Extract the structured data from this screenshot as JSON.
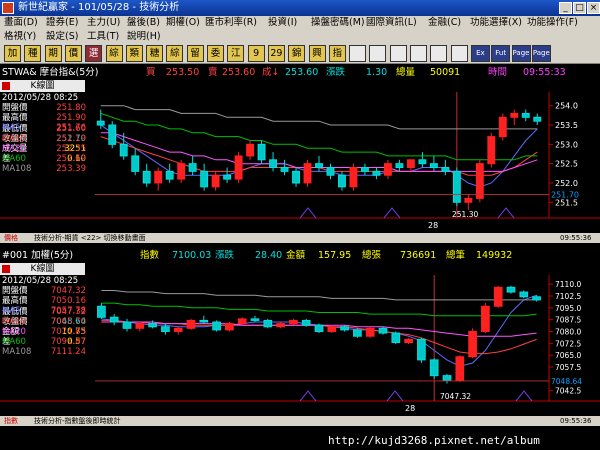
{
  "window": {
    "title": "新世紀贏家 - 101/05/28 - 技術分析"
  },
  "menu_row1": [
    "畫面(D)",
    "證券(E)",
    "主力(U)",
    "盤後(B)",
    "期權(O)",
    "匯市利率(R)",
    "投資(I)",
    "操盤密碼(M)",
    "國際資訊(L)",
    "金融(C)",
    "功能選擇(X)",
    "功能操作(F)"
  ],
  "menu_row2": [
    "格視(Y)",
    "設定(S)",
    "工具(T)",
    "說明(H)"
  ],
  "toolbar": [
    {
      "label": "加",
      "icon": "add-icon"
    },
    {
      "label": "種",
      "icon": "type-icon"
    },
    {
      "label": "期",
      "icon": "futures-icon"
    },
    {
      "label": "價",
      "icon": "price-icon"
    },
    {
      "label": "選",
      "icon": "select-icon"
    },
    {
      "label": "綜",
      "icon": "overview-icon"
    },
    {
      "label": "類",
      "icon": "category-icon"
    },
    {
      "label": "糖",
      "icon": "sugar-icon"
    },
    {
      "label": "綜",
      "icon": "composite-icon"
    },
    {
      "label": "留",
      "icon": "hold-icon"
    },
    {
      "label": "委",
      "icon": "order-icon"
    },
    {
      "label": "江",
      "icon": "river-icon"
    },
    {
      "label": "9",
      "icon": "nine-icon"
    },
    {
      "label": "29",
      "icon": "twentynine-icon"
    },
    {
      "label": "錦",
      "icon": "brocade-icon"
    },
    {
      "label": "興",
      "icon": "prosper-icon"
    },
    {
      "label": "指",
      "icon": "index-icon"
    },
    {
      "label": "",
      "icon": "grid-icon"
    },
    {
      "label": "",
      "icon": "chart-icon"
    },
    {
      "label": "",
      "icon": "table-icon"
    },
    {
      "label": "",
      "icon": "layout-icon"
    },
    {
      "label": "",
      "icon": "screen-icon"
    },
    {
      "label": "",
      "icon": "monitor-icon"
    },
    {
      "label": "Ex",
      "icon": "ex-icon"
    },
    {
      "label": "Fut",
      "icon": "fut-icon"
    },
    {
      "label": "Page",
      "icon": "page-up-icon"
    },
    {
      "label": "Page",
      "icon": "page-down-icon"
    }
  ],
  "panel1": {
    "symbol": "STWA& 摩台指&(5分)",
    "buy_label": "買",
    "buy_value": "253.50",
    "sell_label": "賣",
    "sell_value": "253.60",
    "last_label": "成↓",
    "last_value": "253.60",
    "change_label": "漲跌",
    "change_value": "1.30",
    "volume_label": "總量",
    "volume_value": "50091",
    "time_label": "時間",
    "time_value": "09:55:33",
    "chart_label": "K線圖",
    "datetime": "2012/05/28 08:25",
    "stats": [
      {
        "k": "開盤價",
        "v": "251.80"
      },
      {
        "k": "最高價",
        "v": "251.90"
      },
      {
        "k": "最低價",
        "v": "251.60"
      },
      {
        "k": "收盤價",
        "v": "251.70"
      },
      {
        "k": "成交量",
        "v": "3251"
      },
      {
        "k": "差",
        "v": "0.10"
      }
    ],
    "ma": [
      {
        "k": "MA5",
        "v": "251.76",
        "color": "#5b6cff"
      },
      {
        "k": "MA10",
        "v": "252.19",
        "color": "#ff4040"
      },
      {
        "k": "MA20",
        "v": "252.35",
        "color": "#ff55ff"
      },
      {
        "k": "MA60",
        "v": "252.69",
        "color": "#00c000"
      },
      {
        "k": "MA108",
        "v": "253.39",
        "color": "#9a9a9a"
      }
    ],
    "yticks": [
      "254.0",
      "253.5",
      "253.0",
      "252.5",
      "252.0",
      "251.5"
    ],
    "current_price_tag": "251.70",
    "high_annotation": "254.10",
    "low_annotation": "251.30",
    "xlabel": "28",
    "status_left": "價格",
    "status_text": "技術分析-期貨  <22> 切換移動畫面",
    "status_right": "09:55:36"
  },
  "panel2": {
    "symbol": "#001 加權(5分)",
    "index_label": "指數",
    "index_value": "7100.03",
    "change_label": "漲跌",
    "change_value": "28.40",
    "amount_label": "金額",
    "amount_value": "157.95",
    "volume_label": "總張",
    "volume_value": "736691",
    "count_label": "總筆",
    "count_value": "149932",
    "chart_label": "K線圖",
    "datetime": "2012/05/28 08:25",
    "stats": [
      {
        "k": "開盤價",
        "v": "7047.32"
      },
      {
        "k": "最高價",
        "v": "7050.16"
      },
      {
        "k": "最低價",
        "v": "7047.32"
      },
      {
        "k": "收盤價",
        "v": "7048.64"
      },
      {
        "k": "金額",
        "v": "10.75"
      },
      {
        "k": "差",
        "v": "0.57"
      }
    ],
    "ma": [
      {
        "k": "MA5",
        "v": "7057.78",
        "color": "#5b6cff"
      },
      {
        "k": "MA10",
        "v": "7065.70",
        "color": "#ff4040"
      },
      {
        "k": "MA20",
        "v": "7074.83",
        "color": "#ff55ff"
      },
      {
        "k": "MA60",
        "v": "7091.87",
        "color": "#00c000"
      },
      {
        "k": "MA108",
        "v": "7111.24",
        "color": "#9a9a9a"
      }
    ],
    "yticks": [
      "7110.0",
      "7102.5",
      "7095.0",
      "7087.5",
      "7080.0",
      "7072.5",
      "7065.0",
      "7057.5",
      "7050.0",
      "7042.5"
    ],
    "current_price_tag": "7048.64",
    "high_annotation": "7109.14",
    "low_annotation": "7047.32",
    "xlabel": "28",
    "status_left": "指數",
    "status_text": "技術分析-指數盤後即時統計",
    "status_right": "09:55:36"
  },
  "watermark": "http://kujd3268.pixnet.net/album",
  "colors": {
    "up": "#ff2020",
    "down": "#00c8c8",
    "bg": "#000000",
    "axis": "#c00000",
    "neutral": "#ffffff"
  },
  "chart_data": [
    {
      "type": "candlestick",
      "title": "STWA& 摩台指&(5分)",
      "xlabel": "28",
      "ylim": [
        251.3,
        254.2
      ],
      "candles": [
        [
          253.6,
          253.9,
          253.4,
          253.5
        ],
        [
          253.5,
          253.6,
          252.9,
          253.0
        ],
        [
          253.0,
          253.3,
          252.6,
          252.7
        ],
        [
          252.7,
          252.9,
          252.2,
          252.3
        ],
        [
          252.3,
          252.5,
          251.9,
          252.0
        ],
        [
          252.0,
          252.4,
          251.8,
          252.3
        ],
        [
          252.3,
          252.5,
          252.0,
          252.1
        ],
        [
          252.1,
          252.6,
          252.0,
          252.5
        ],
        [
          252.5,
          252.7,
          252.2,
          252.3
        ],
        [
          252.3,
          252.5,
          251.8,
          251.9
        ],
        [
          251.9,
          252.3,
          251.8,
          252.2
        ],
        [
          252.2,
          252.4,
          252.0,
          252.1
        ],
        [
          252.1,
          252.8,
          252.0,
          252.7
        ],
        [
          252.7,
          253.1,
          252.6,
          253.0
        ],
        [
          253.0,
          253.1,
          252.5,
          252.6
        ],
        [
          252.6,
          252.8,
          252.3,
          252.4
        ],
        [
          252.4,
          252.6,
          252.2,
          252.3
        ],
        [
          252.3,
          252.4,
          251.9,
          252.0
        ],
        [
          252.0,
          252.6,
          251.9,
          252.5
        ],
        [
          252.5,
          252.7,
          252.3,
          252.4
        ],
        [
          252.4,
          252.5,
          252.1,
          252.2
        ],
        [
          252.2,
          252.3,
          251.8,
          251.9
        ],
        [
          251.9,
          252.5,
          251.8,
          252.4
        ],
        [
          252.4,
          252.5,
          252.2,
          252.3
        ],
        [
          252.3,
          252.4,
          252.1,
          252.2
        ],
        [
          252.2,
          252.6,
          252.1,
          252.5
        ],
        [
          252.5,
          252.6,
          252.3,
          252.4
        ],
        [
          252.4,
          252.6,
          252.3,
          252.6
        ],
        [
          252.6,
          252.8,
          252.4,
          252.5
        ],
        [
          252.5,
          252.7,
          252.3,
          252.4
        ],
        [
          252.4,
          252.6,
          252.2,
          252.3
        ],
        [
          252.3,
          252.4,
          251.4,
          251.5
        ],
        [
          251.5,
          251.7,
          251.3,
          251.6
        ],
        [
          251.6,
          252.6,
          251.5,
          252.5
        ],
        [
          252.5,
          253.3,
          252.4,
          253.2
        ],
        [
          253.2,
          253.8,
          253.1,
          253.7
        ],
        [
          253.7,
          253.9,
          253.5,
          253.8
        ],
        [
          253.8,
          253.9,
          253.6,
          253.7
        ],
        [
          253.7,
          253.8,
          253.5,
          253.6
        ]
      ],
      "series": [
        {
          "name": "MA5",
          "values": [
            253.5,
            253.3,
            253.1,
            252.9,
            252.7,
            252.5,
            252.3,
            252.2,
            252.2,
            252.2,
            252.2,
            252.2,
            252.3,
            252.4,
            252.5,
            252.5,
            252.5,
            252.4,
            252.3,
            252.3,
            252.3,
            252.2,
            252.2,
            252.2,
            252.2,
            252.3,
            252.3,
            252.3,
            252.4,
            252.4,
            252.4,
            252.2,
            252.0,
            251.9,
            252.0,
            252.3,
            252.7,
            253.1,
            253.4
          ]
        },
        {
          "name": "MA10",
          "values": [
            253.2,
            253.1,
            253.0,
            252.9,
            252.8,
            252.7,
            252.6,
            252.5,
            252.4,
            252.3,
            252.3,
            252.3,
            252.3,
            252.4,
            252.4,
            252.4,
            252.4,
            252.4,
            252.4,
            252.4,
            252.3,
            252.3,
            252.3,
            252.3,
            252.3,
            252.3,
            252.3,
            252.3,
            252.3,
            252.3,
            252.3,
            252.3,
            252.2,
            252.2,
            252.2,
            252.3,
            252.4,
            252.6,
            252.8
          ]
        },
        {
          "name": "MA20",
          "values": [
            253.3,
            253.3,
            253.2,
            253.1,
            253.0,
            252.9,
            252.8,
            252.8,
            252.7,
            252.7,
            252.6,
            252.6,
            252.5,
            252.5,
            252.5,
            252.5,
            252.5,
            252.4,
            252.4,
            252.4,
            252.4,
            252.4,
            252.4,
            252.4,
            252.4,
            252.4,
            252.3,
            252.3,
            252.3,
            252.3,
            252.3,
            252.3,
            252.3,
            252.3,
            252.3,
            252.3,
            252.4,
            252.5,
            252.6
          ]
        },
        {
          "name": "MA60",
          "values": [
            253.8,
            253.7,
            253.6,
            253.6,
            253.5,
            253.5,
            253.4,
            253.4,
            253.3,
            253.3,
            253.2,
            253.2,
            253.2,
            253.1,
            253.1,
            253.0,
            253.0,
            253.0,
            252.9,
            252.9,
            252.9,
            252.8,
            252.8,
            252.8,
            252.8,
            252.7,
            252.7,
            252.7,
            252.7,
            252.7,
            252.7,
            252.6,
            252.6,
            252.6,
            252.6,
            252.6,
            252.6,
            252.7,
            252.7
          ]
        },
        {
          "name": "MA108",
          "values": [
            254.0,
            254.0,
            254.0,
            253.9,
            253.9,
            253.9,
            253.9,
            253.8,
            253.8,
            253.8,
            253.8,
            253.7,
            253.7,
            253.7,
            253.7,
            253.6,
            253.6,
            253.6,
            253.6,
            253.6,
            253.5,
            253.5,
            253.5,
            253.5,
            253.5,
            253.5,
            253.4,
            253.4,
            253.4,
            253.4,
            253.4,
            253.4,
            253.4,
            253.4,
            253.4,
            253.4,
            253.4,
            253.4,
            253.4
          ]
        }
      ]
    },
    {
      "type": "candlestick",
      "title": "#001 加權(5分)",
      "xlabel": "28",
      "ylim": [
        7041,
        7112
      ],
      "candles": [
        [
          7096,
          7098,
          7088,
          7089
        ],
        [
          7089,
          7091,
          7084,
          7086
        ],
        [
          7086,
          7088,
          7080,
          7082
        ],
        [
          7082,
          7086,
          7080,
          7085
        ],
        [
          7085,
          7087,
          7082,
          7083
        ],
        [
          7083,
          7085,
          7078,
          7080
        ],
        [
          7080,
          7083,
          7078,
          7082
        ],
        [
          7082,
          7088,
          7081,
          7087
        ],
        [
          7087,
          7090,
          7085,
          7086
        ],
        [
          7086,
          7087,
          7080,
          7081
        ],
        [
          7081,
          7086,
          7080,
          7085
        ],
        [
          7085,
          7089,
          7084,
          7088
        ],
        [
          7088,
          7090,
          7086,
          7087
        ],
        [
          7087,
          7088,
          7082,
          7083
        ],
        [
          7083,
          7086,
          7082,
          7085
        ],
        [
          7085,
          7088,
          7084,
          7087
        ],
        [
          7087,
          7088,
          7083,
          7084
        ],
        [
          7084,
          7085,
          7079,
          7080
        ],
        [
          7080,
          7084,
          7079,
          7083
        ],
        [
          7083,
          7084,
          7080,
          7081
        ],
        [
          7081,
          7082,
          7076,
          7077
        ],
        [
          7077,
          7083,
          7076,
          7082
        ],
        [
          7082,
          7083,
          7078,
          7079
        ],
        [
          7079,
          7080,
          7072,
          7073
        ],
        [
          7073,
          7076,
          7072,
          7075
        ],
        [
          7075,
          7076,
          7060,
          7062
        ],
        [
          7062,
          7063,
          7050,
          7052
        ],
        [
          7052,
          7053,
          7047,
          7049
        ],
        [
          7049,
          7065,
          7048,
          7064
        ],
        [
          7064,
          7082,
          7063,
          7080
        ],
        [
          7080,
          7098,
          7079,
          7096
        ],
        [
          7096,
          7109,
          7095,
          7108
        ],
        [
          7108,
          7109,
          7104,
          7105
        ],
        [
          7105,
          7106,
          7101,
          7102
        ],
        [
          7102,
          7103,
          7099,
          7100
        ]
      ],
      "series": [
        {
          "name": "MA5",
          "values": [
            7088,
            7087,
            7086,
            7085,
            7084,
            7084,
            7083,
            7083,
            7083,
            7084,
            7084,
            7085,
            7086,
            7086,
            7086,
            7086,
            7085,
            7084,
            7083,
            7082,
            7081,
            7081,
            7080,
            7079,
            7077,
            7074,
            7068,
            7062,
            7058,
            7060,
            7068,
            7080,
            7092,
            7100,
            7103
          ]
        },
        {
          "name": "MA10",
          "values": [
            7087,
            7087,
            7086,
            7086,
            7085,
            7085,
            7085,
            7084,
            7084,
            7084,
            7084,
            7084,
            7084,
            7084,
            7084,
            7084,
            7084,
            7084,
            7083,
            7083,
            7082,
            7081,
            7080,
            7079,
            7078,
            7076,
            7073,
            7070,
            7067,
            7066,
            7066,
            7067,
            7069,
            7072,
            7075
          ]
        },
        {
          "name": "MA20",
          "values": [
            7086,
            7086,
            7086,
            7086,
            7086,
            7085,
            7085,
            7085,
            7085,
            7085,
            7085,
            7084,
            7084,
            7084,
            7084,
            7084,
            7084,
            7084,
            7084,
            7084,
            7083,
            7083,
            7083,
            7082,
            7082,
            7081,
            7080,
            7079,
            7078,
            7077,
            7077,
            7077,
            7077,
            7078,
            7079
          ]
        },
        {
          "name": "MA60",
          "values": [
            7098,
            7098,
            7097,
            7097,
            7096,
            7096,
            7096,
            7095,
            7095,
            7095,
            7094,
            7094,
            7094,
            7093,
            7093,
            7093,
            7093,
            7092,
            7092,
            7092,
            7092,
            7091,
            7091,
            7091,
            7091,
            7091,
            7090,
            7090,
            7090,
            7090,
            7090,
            7090,
            7090,
            7090,
            7091
          ]
        },
        {
          "name": "MA108",
          "values": [
            7106,
            7106,
            7105,
            7105,
            7105,
            7104,
            7104,
            7104,
            7104,
            7103,
            7103,
            7103,
            7103,
            7102,
            7102,
            7102,
            7102,
            7102,
            7101,
            7101,
            7101,
            7101,
            7101,
            7100,
            7100,
            7100,
            7100,
            7100,
            7100,
            7100,
            7100,
            7100,
            7100,
            7100,
            7100
          ]
        }
      ]
    }
  ]
}
